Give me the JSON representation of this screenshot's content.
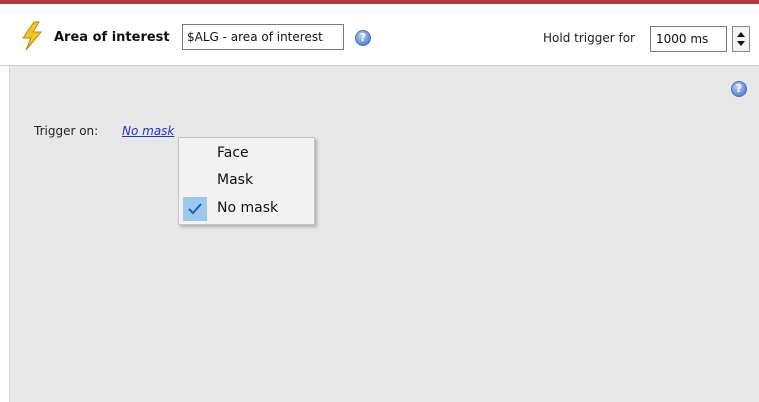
{
  "header": {
    "title": "Area of interest",
    "name_value": "$ALG - area of interest",
    "hold_label": "Hold trigger for",
    "hold_value": "1000 ms",
    "help_glyph": "?"
  },
  "body": {
    "trigger_label": "Trigger on:",
    "trigger_value": "No mask",
    "help_glyph": "?"
  },
  "menu": {
    "items": [
      {
        "label": "Face",
        "checked": false
      },
      {
        "label": "Mask",
        "checked": false
      },
      {
        "label": "No mask",
        "checked": true
      }
    ]
  },
  "icons": {
    "title_icon": "lightning-bolt-icon",
    "help_icon": "help-icon",
    "check_icon": "checkmark-icon"
  },
  "colors": {
    "accent_bar": "#b8383f",
    "link": "#2233cc",
    "menu_selection": "#9cc8ee",
    "background": "#e8e8e8"
  }
}
